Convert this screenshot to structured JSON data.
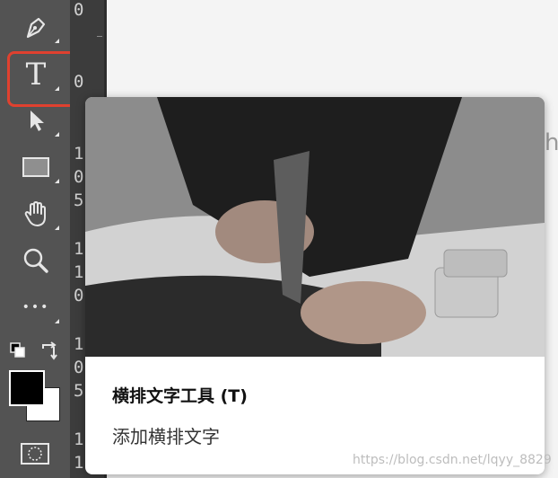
{
  "toolbar": {
    "tools": [
      {
        "name": "pen-tool",
        "icon": "pen-icon"
      },
      {
        "name": "type-tool",
        "icon": "type-icon",
        "glyph": "T",
        "selected": true
      },
      {
        "name": "move-tool",
        "icon": "arrow-pointer-icon"
      },
      {
        "name": "rectangle-tool",
        "icon": "rectangle-icon"
      },
      {
        "name": "hand-tool",
        "icon": "hand-icon"
      },
      {
        "name": "zoom-tool",
        "icon": "magnifier-icon"
      },
      {
        "name": "more-tools",
        "icon": "ellipsis-icon",
        "glyph": "•••"
      }
    ],
    "foreground_color": "#000000",
    "background_color": "#ffffff"
  },
  "ruler": {
    "digits": [
      "0",
      "0",
      "1",
      "0",
      "5",
      "1",
      "1",
      "0",
      "1",
      "0",
      "5",
      "1",
      "1"
    ]
  },
  "canvas": {
    "edge_text": "h"
  },
  "tooltip": {
    "title": "横排文字工具 (T)",
    "description": "添加横排文字"
  },
  "watermark": "https://blog.csdn.net/lqyy_8829",
  "colors": {
    "toolbar_bg": "#535353",
    "highlight": "#e0412f",
    "ruler_bg": "#3c3c3c"
  }
}
